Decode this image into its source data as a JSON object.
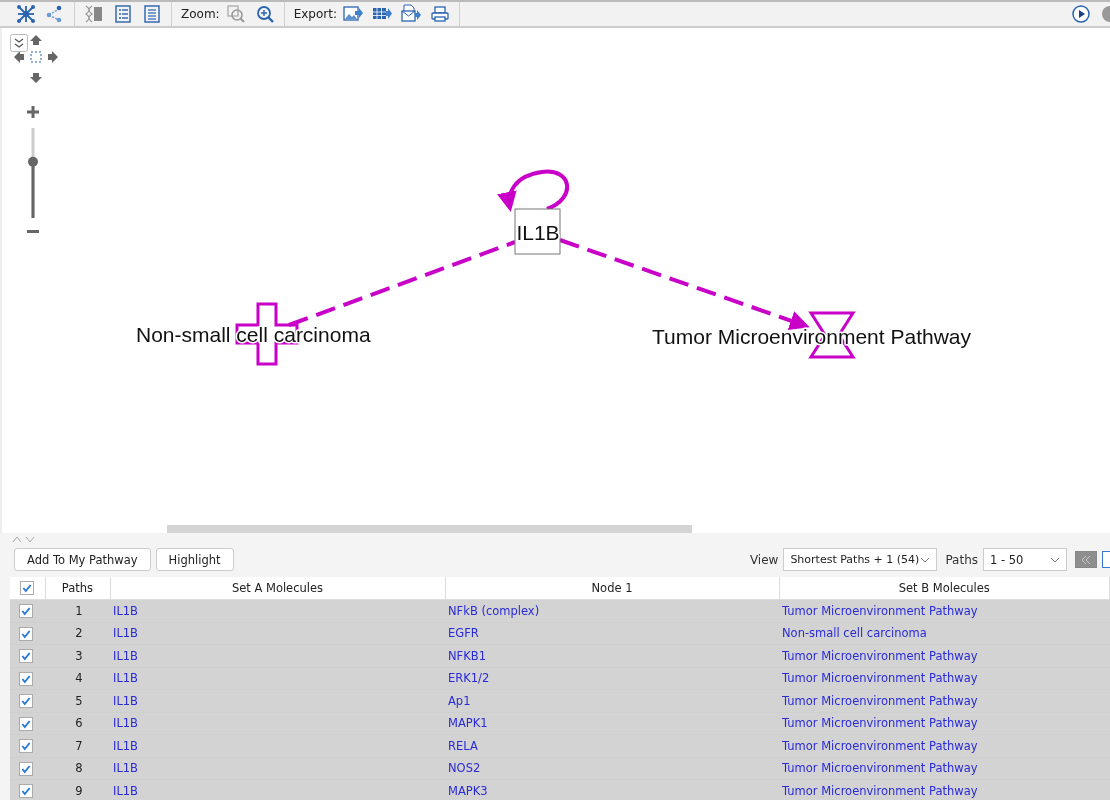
{
  "toolbar": {
    "zoom_label": "Zoom:",
    "export_label": "Export:"
  },
  "navigator": {
    "zoom": {
      "level": 0.65
    }
  },
  "graph": {
    "nodes": [
      {
        "label": "IL1B",
        "kind": "gene"
      },
      {
        "label": "Non-small cell carcinoma",
        "kind": "disease"
      },
      {
        "label": "Tumor Microenvironment Pathway",
        "kind": "pathway"
      }
    ]
  },
  "actions": [
    "Add To My Pathway",
    "Highlight"
  ],
  "view": {
    "label": "View",
    "value": "Shortest Paths + 1 (54)"
  },
  "paths": {
    "label": "Paths",
    "value": "1 - 50"
  },
  "table": {
    "all_checked": true,
    "columns": [
      "Paths",
      "Set A Molecules",
      "Node 1",
      "Set B Molecules"
    ],
    "rows": [
      {
        "checked": true,
        "selected": true,
        "path": "1",
        "set_a": "IL1B",
        "node_1": "NFkB (complex)",
        "set_b": "Tumor Microenvironment Pathway"
      },
      {
        "checked": true,
        "selected": true,
        "path": "2",
        "set_a": "IL1B",
        "node_1": "EGFR",
        "set_b": "Non-small cell carcinoma"
      },
      {
        "checked": true,
        "selected": true,
        "path": "3",
        "set_a": "IL1B",
        "node_1": "NFKB1",
        "set_b": "Tumor Microenvironment Pathway"
      },
      {
        "checked": true,
        "selected": true,
        "path": "4",
        "set_a": "IL1B",
        "node_1": "ERK1/2",
        "set_b": "Tumor Microenvironment Pathway"
      },
      {
        "checked": true,
        "selected": true,
        "path": "5",
        "set_a": "IL1B",
        "node_1": "Ap1",
        "set_b": "Tumor Microenvironment Pathway"
      },
      {
        "checked": true,
        "selected": true,
        "path": "6",
        "set_a": "IL1B",
        "node_1": "MAPK1",
        "set_b": "Tumor Microenvironment Pathway"
      },
      {
        "checked": true,
        "selected": true,
        "path": "7",
        "set_a": "IL1B",
        "node_1": "RELA",
        "set_b": "Tumor Microenvironment Pathway"
      },
      {
        "checked": true,
        "selected": true,
        "path": "8",
        "set_a": "IL1B",
        "node_1": "NOS2",
        "set_b": "Tumor Microenvironment Pathway"
      },
      {
        "checked": true,
        "selected": true,
        "path": "9",
        "set_a": "IL1B",
        "node_1": "MAPK3",
        "set_b": "Tumor Microenvironment Pathway"
      }
    ]
  }
}
